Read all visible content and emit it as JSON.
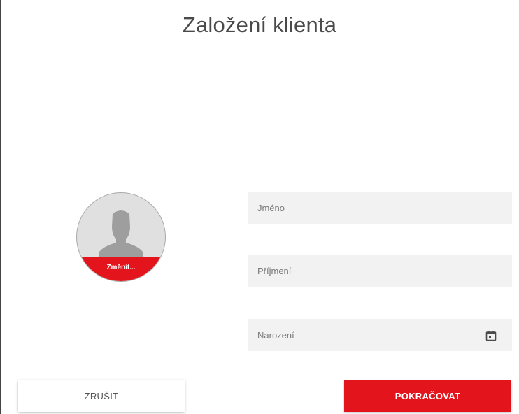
{
  "header": {
    "title": "Založení klienta"
  },
  "avatar": {
    "change_label": "Změnit...",
    "icon": "person-silhouette-icon"
  },
  "form": {
    "first_name": {
      "placeholder": "Jméno",
      "value": ""
    },
    "last_name": {
      "placeholder": "Příjmení",
      "value": ""
    },
    "birth_date": {
      "placeholder": "Narození",
      "value": "",
      "icon": "calendar-icon"
    }
  },
  "actions": {
    "cancel_label": "ZRUŠIT",
    "continue_label": "POKRAČOVAT"
  },
  "colors": {
    "accent": "#e3141b",
    "field_background": "#f2f2f2",
    "avatar_background": "#e0e0e0",
    "silhouette": "#9e9e9e"
  }
}
